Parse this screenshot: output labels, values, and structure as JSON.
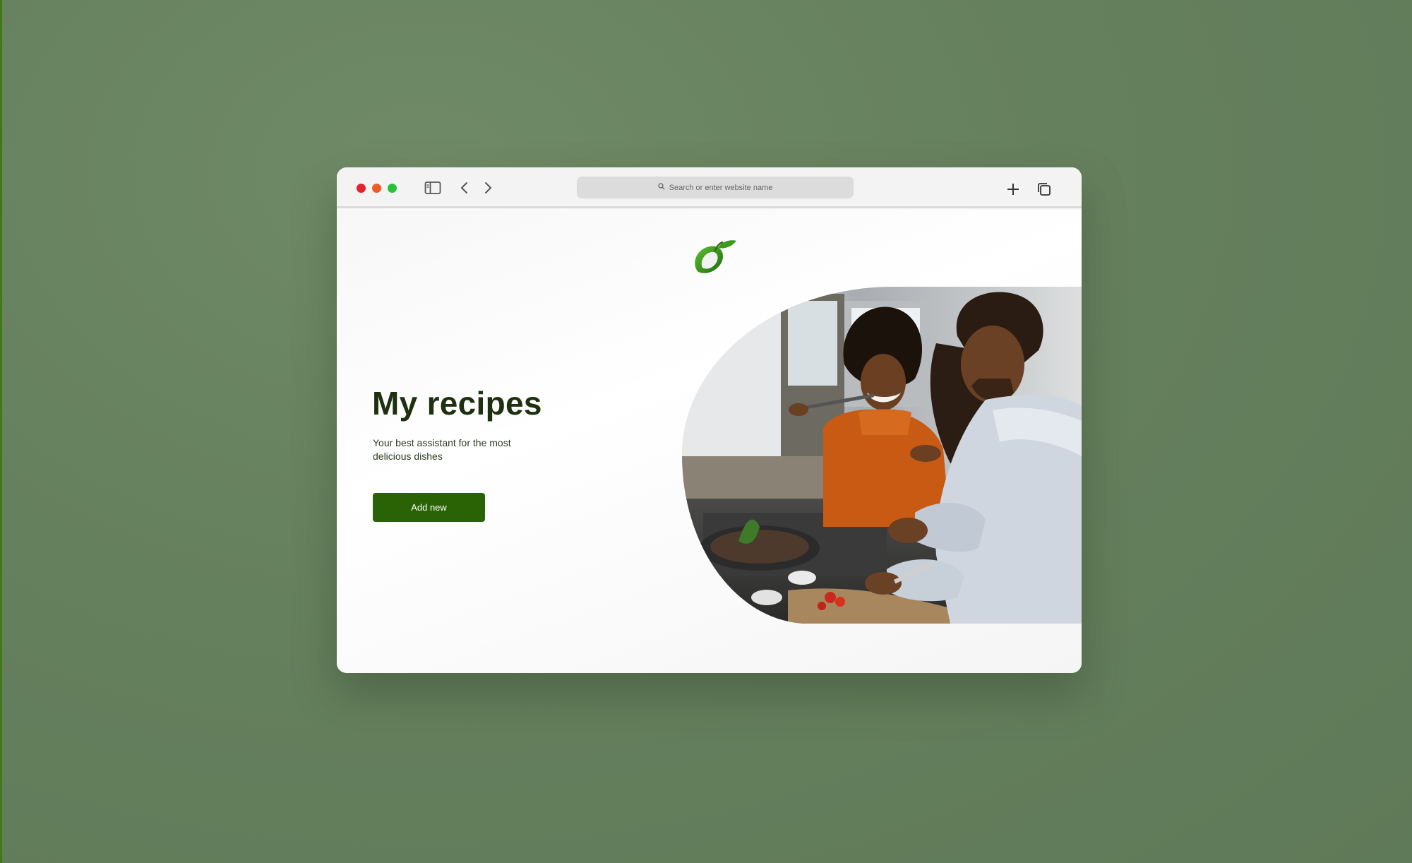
{
  "browser": {
    "address_placeholder": "Search or enter website name",
    "icons": [
      "sidebar-icon",
      "chevron-left-icon",
      "chevron-right-icon",
      "search-icon",
      "plus-icon",
      "tabs-icon"
    ]
  },
  "page": {
    "title": "My recipes",
    "subtitle": "Your best assistant for the most delicious dishes",
    "cta_label": "Add new"
  },
  "colors": {
    "background": "#66815e",
    "brand_green": "#2a6305",
    "title_color": "#1e3010"
  }
}
